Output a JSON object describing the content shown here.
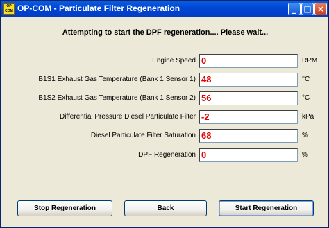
{
  "window": {
    "title": "OP-COM - Particulate Filter Regeneration",
    "icon_text": "OP COM"
  },
  "status_text": "Attempting to start the DPF regeneration.... Please wait...",
  "params": [
    {
      "label": "Engine Speed",
      "value": "0",
      "unit": "RPM"
    },
    {
      "label": "B1S1 Exhaust Gas Temperature (Bank 1 Sensor 1)",
      "value": "48",
      "unit": "°C"
    },
    {
      "label": "B1S2 Exhaust Gas Temperature (Bank 1 Sensor 2)",
      "value": "56",
      "unit": "°C"
    },
    {
      "label": "Differential Pressure Diesel Particulate Filter",
      "value": "-2",
      "unit": "kPa"
    },
    {
      "label": "Diesel Particulate Filter Saturation",
      "value": "68",
      "unit": "%"
    },
    {
      "label": "DPF Regeneration",
      "value": "0",
      "unit": "%"
    }
  ],
  "buttons": {
    "stop": "Stop Regeneration",
    "back": "Back",
    "start": "Start Regeneration"
  },
  "colors": {
    "value_text": "#e00000",
    "title_bar": "#0047d6",
    "window_bg": "#ece9d8"
  }
}
